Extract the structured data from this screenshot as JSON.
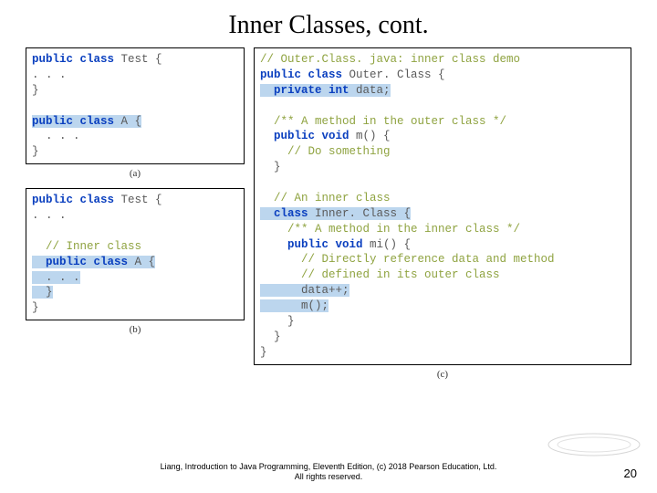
{
  "title": "Inner Classes, cont.",
  "footer_line1": "Liang, Introduction to Java Programming, Eleventh Edition, (c) 2018 Pearson Education, Ltd.",
  "footer_line2": "All rights reserved.",
  "page_number": "20",
  "captions": {
    "a": "(a)",
    "b": "(b)",
    "c": "(c)"
  },
  "code": {
    "a_l1_pre": "public class ",
    "a_l1_name": "Test {",
    "a_l2": ". . .",
    "a_l3": "}",
    "a_l4_pre": "public class ",
    "a_l4_name": "A {",
    "a_l5": "  . . .",
    "a_l6": "}",
    "b_l1_pre": "public class ",
    "b_l1_name": "Test {",
    "b_l2": ". . .",
    "b_blank": " ",
    "b_l3": "  // Inner class",
    "b_l4_pre": "  public class ",
    "b_l4_name": "A {",
    "b_l5": "  . . .",
    "b_l6": "  }",
    "b_l7": "}",
    "c_l1": "// Outer.Class. java: inner class demo",
    "c_l2_pre": "public class ",
    "c_l2_name": "Outer. Class {",
    "c_l3_pre": "  private int ",
    "c_l3_name": "data;",
    "c_l4": "  /** A method in the outer class */",
    "c_l5_pre": "  public void ",
    "c_l5_name": "m() {",
    "c_l6": "    // Do something",
    "c_l7": "  }",
    "c_l8": "  // An inner class",
    "c_l9_pre": "  class ",
    "c_l9_name": "Inner. Class {",
    "c_l10": "    /** A method in the inner class */",
    "c_l11_pre": "    public void ",
    "c_l11_name": "mi() {",
    "c_l12": "      // Directly reference data and method",
    "c_l13": "      // defined in its outer class",
    "c_l14": "      data++;",
    "c_l15": "      m();",
    "c_l16": "    }",
    "c_l17": "  }",
    "c_l18": "}"
  }
}
